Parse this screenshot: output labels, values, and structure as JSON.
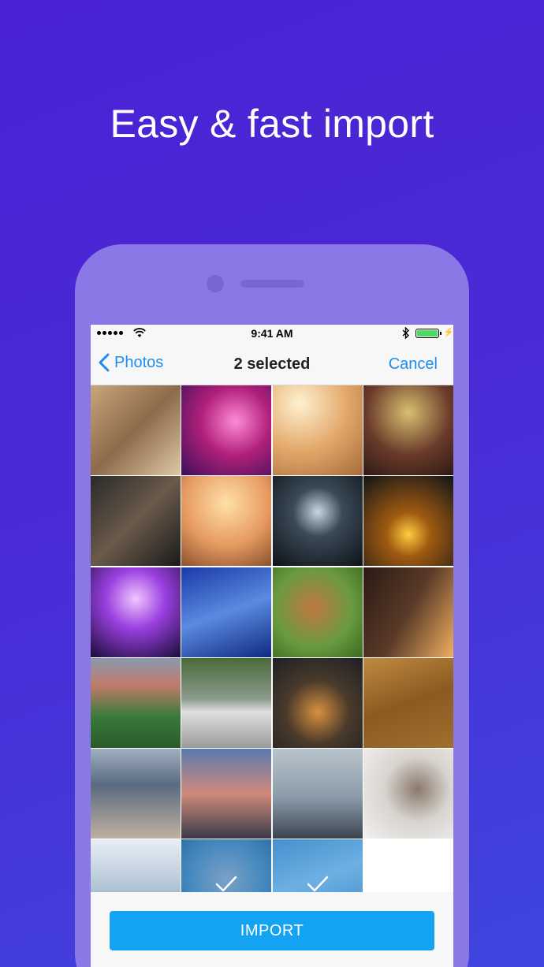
{
  "headline": "Easy & fast import",
  "statusbar": {
    "time": "9:41 AM"
  },
  "navbar": {
    "back_label": "Photos",
    "title": "2 selected",
    "cancel_label": "Cancel"
  },
  "photos": [
    {
      "name": "photo-beach-reading",
      "bg": "linear-gradient(135deg,#c9a67a,#8c6a4a 50%,#e0c9a5)",
      "selected": false
    },
    {
      "name": "photo-party-lights",
      "bg": "radial-gradient(circle at 60% 40%,#ff8ad8,#b0207a 45%,#3a0f5a)",
      "selected": false
    },
    {
      "name": "photo-sunny-woman",
      "bg": "radial-gradient(circle at 30% 20%,#fff1d0,#e2a86a 50%,#a66b3a)",
      "selected": false
    },
    {
      "name": "photo-festival-girls",
      "bg": "radial-gradient(circle at 50% 30%,#d8c070,#6a3a2a 55%,#2e1a14)",
      "selected": false
    },
    {
      "name": "photo-gym",
      "bg": "linear-gradient(135deg,#2a2a2a,#6a5a4a 50%,#1a1a1a)",
      "selected": false
    },
    {
      "name": "photo-heart-hands",
      "bg": "radial-gradient(circle at 50% 30%,#ffe0a8,#e69a60 55%,#8a5030)",
      "selected": false
    },
    {
      "name": "photo-concert-crowd",
      "bg": "radial-gradient(circle at 50% 40%,#c9d6e0,#3a4a58 35%,#0e1216)",
      "selected": false
    },
    {
      "name": "photo-concert-orange",
      "bg": "radial-gradient(circle at 50% 65%,#ffcc40,#a05a10 30%,#101418)",
      "selected": false
    },
    {
      "name": "photo-rave-purple",
      "bg": "radial-gradient(circle at 50% 35%,#f2c6ff,#9a40e0 40%,#1a0c38)",
      "selected": false
    },
    {
      "name": "photo-blue-clouds",
      "bg": "linear-gradient(160deg,#1a3aa8,#5a8ae0 50%,#0e2a80)",
      "selected": false
    },
    {
      "name": "photo-boxer-dog",
      "bg": "radial-gradient(circle at 45% 45%,#c07840,#6a9a40 55%,#3a6a20)",
      "selected": false
    },
    {
      "name": "photo-city-sunset",
      "bg": "linear-gradient(120deg,#2a1a14,#5a3a28 50%,#f0b060)",
      "selected": false
    },
    {
      "name": "photo-baseball-field",
      "bg": "linear-gradient(180deg,#8a9ab0,#c07a6a 30%,#3a7a3a 65%,#2a5a2a)",
      "selected": false
    },
    {
      "name": "photo-white-car",
      "bg": "linear-gradient(180deg,#4a6a3a,#8a9a8a 45%,#e0e0e0 60%,#9a9a9a)",
      "selected": false
    },
    {
      "name": "photo-burger",
      "bg": "radial-gradient(circle at 50% 60%,#d89040,#4a3a2a 45%,#1c2026)",
      "selected": false
    },
    {
      "name": "photo-autumn-bike",
      "bg": "linear-gradient(160deg,#c08a40,#8a5a20 50%,#a07030)",
      "selected": false
    },
    {
      "name": "photo-surfers",
      "bg": "linear-gradient(180deg,#a0b0c0,#5a6a80 40%,#c0b0a0)",
      "selected": false
    },
    {
      "name": "photo-beach-group",
      "bg": "linear-gradient(180deg,#5a7ab0,#d08a7a 50%,#3a3a4a)",
      "selected": false
    },
    {
      "name": "photo-lake-man",
      "bg": "linear-gradient(180deg,#b8c4cc,#8a9aa8 55%,#3a4450)",
      "selected": false
    },
    {
      "name": "photo-cat",
      "bg": "radial-gradient(circle at 60% 45%,#8a7a6a,#d8d4d0 45%,#f2f0ee)",
      "selected": false
    },
    {
      "name": "photo-boat-dog",
      "bg": "linear-gradient(180deg,#e8eef4,#b0c4d4 55%,#6a5040)",
      "selected": false
    },
    {
      "name": "photo-couple-selfie",
      "bg": "radial-gradient(circle at 50% 45%,#e0b0a0,#6a7a90 55%,#2a3a4a)",
      "selected": true
    },
    {
      "name": "photo-man-lying",
      "bg": "linear-gradient(160deg,#6a8ab0,#c0d0e0 45%,#5a7aa0)",
      "selected": true
    },
    {
      "name": "photo-empty",
      "bg": "",
      "selected": false,
      "empty": true
    }
  ],
  "import_label": "IMPORT"
}
